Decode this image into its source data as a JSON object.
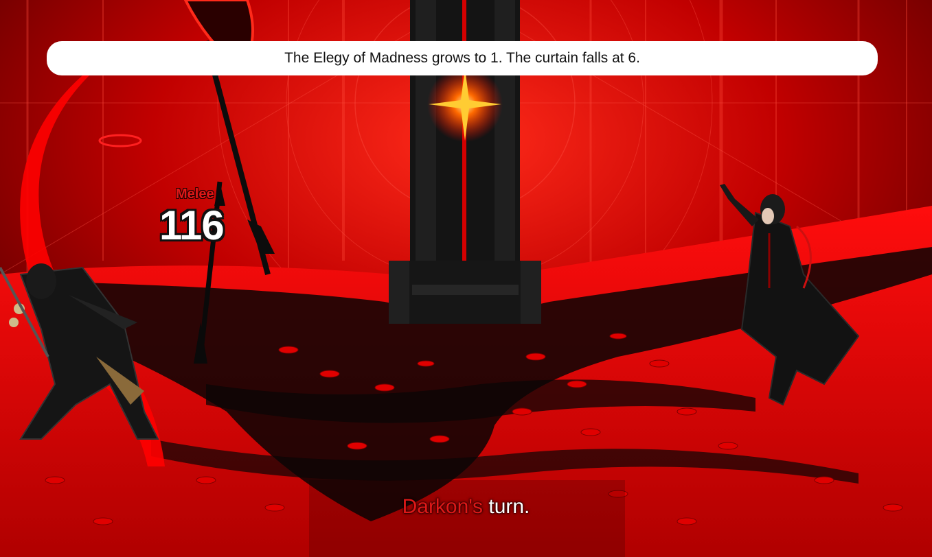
{
  "banner": {
    "text": "The Elegy of Madness grows to 1. The curtain falls at 6."
  },
  "damage_popup": {
    "label": "Melee",
    "value": "116"
  },
  "turn": {
    "actor": "Darkon's",
    "rest": " turn."
  },
  "colors": {
    "accent_red": "#e01818",
    "bg_red": "#c00000",
    "dark": "#0a0a0a"
  }
}
